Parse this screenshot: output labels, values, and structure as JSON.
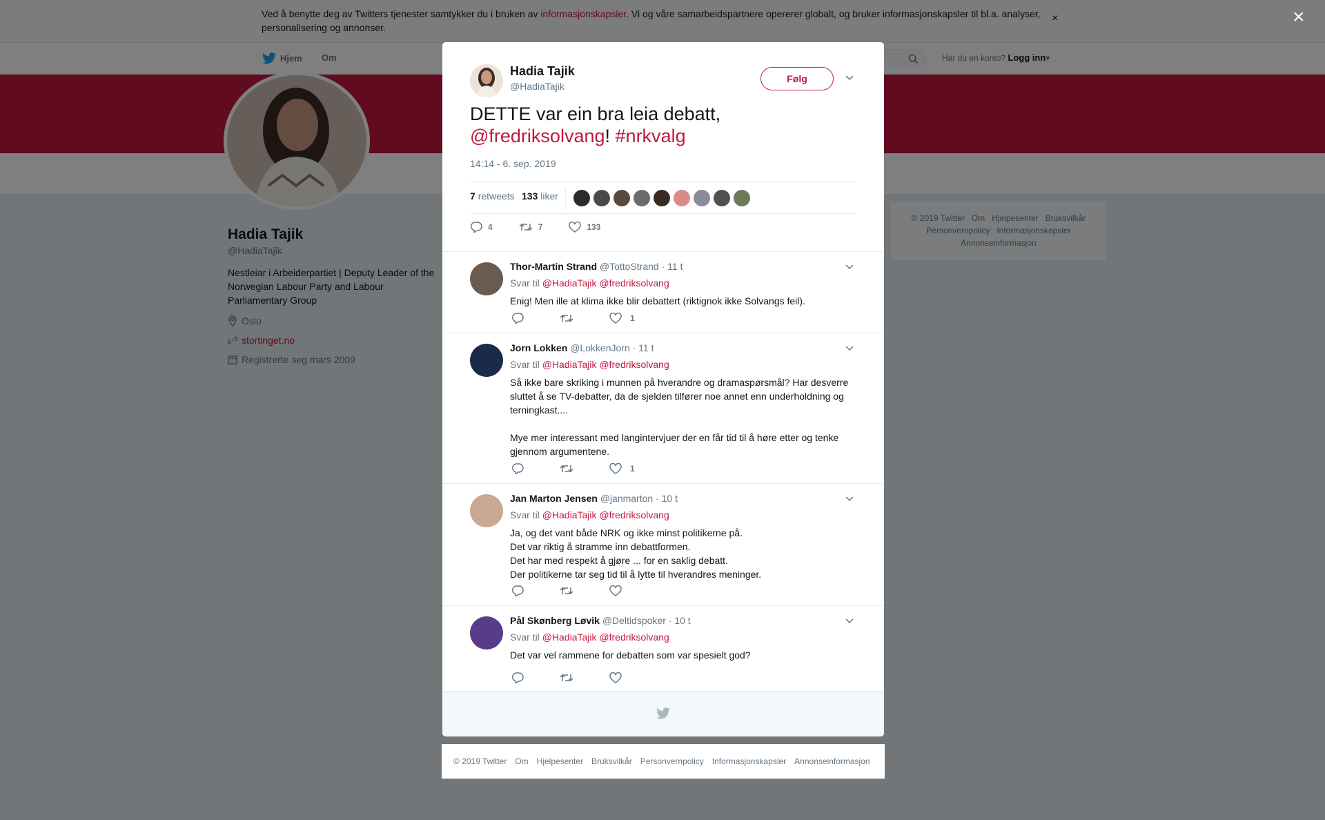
{
  "cookie": {
    "text_before": "Ved å benytte deg av Twitters tjenester samtykker du i bruken av ",
    "link": "informasjonskapsler",
    "text_after": ". Vi og våre samarbeidspartnere opererer globalt, og bruker informasjonskapsler til bl.a. analyser, personalisering og annonser.",
    "close": "×"
  },
  "nav": {
    "home": "Hjem",
    "about": "Om",
    "login_prompt": "Har du en konto?",
    "login": "Logg inn",
    "login_caret": "▾"
  },
  "profile": {
    "name": "Hadia Tajik",
    "handle": "@HadiaTajik",
    "bio": "Nestleiar i Arbeiderpartiet | Deputy Leader of the Norwegian Labour Party and Labour Parliamentary Group",
    "location": "Oslo",
    "website": "stortinget.no",
    "joined": "Registrerte seg mars 2009"
  },
  "right_footer": {
    "items": [
      "© 2019 Twitter",
      "Om",
      "Hjelpesenter",
      "Bruksvilkår",
      "Personvernpolicy",
      "Informasjonskapsler",
      "Annonseinformasjon"
    ]
  },
  "modal_close": "×",
  "tweet": {
    "name": "Hadia Tajik",
    "handle": "@HadiaTajik",
    "follow": "Følg",
    "text": "DETTE var ein bra leia debatt,",
    "mention": "@fredriksolvang",
    "excl": "!",
    "hashtag": "#nrkvalg",
    "time": "14:14 - 6. sep. 2019",
    "retweets_count": "7",
    "retweets_label": "retweets",
    "likes_count": "133",
    "likes_label": "liker",
    "action_replies": "4",
    "action_retweets": "7",
    "action_likes": "133",
    "liker_colors": [
      "#2b2b2b",
      "#4a4a4a",
      "#5a4a3c",
      "#6b6b6b",
      "#3a2a20",
      "#d98a8a",
      "#8a8a9a",
      "#505050",
      "#6a7a5a"
    ]
  },
  "replies": [
    {
      "name": "Thor-Martin Strand",
      "handle": "@TottoStrand",
      "time": "· 11 t",
      "reply_to_label": "Svar til",
      "reply_to_1": "@HadiaTajik",
      "reply_to_2": "@fredriksolvang",
      "body": "Enig! Men ille at klima ikke blir debattert (riktignok ikke Solvangs feil).",
      "likes": "1",
      "avatar_color": "#6b5a4e"
    },
    {
      "name": "Jorn Lokken",
      "handle": "@LokkenJorn",
      "time": "· 11 t",
      "reply_to_label": "Svar til",
      "reply_to_1": "@HadiaTajik",
      "reply_to_2": "@fredriksolvang",
      "body": "Så ikke bare skriking i munnen på hverandre og dramaspørsmål? Har desverre sluttet å se TV-debatter, da de sjelden tilfører noe annet enn underholdning og terningkast....\n\nMye mer interessant med langintervjuer der en får tid til å høre etter og tenke gjennom argumentene.",
      "likes": "1",
      "avatar_color": "#1c2a4a"
    },
    {
      "name": "Jan Marton Jensen",
      "handle": "@janmarton",
      "time": "· 10 t",
      "reply_to_label": "Svar til",
      "reply_to_1": "@HadiaTajik",
      "reply_to_2": "@fredriksolvang",
      "body": "Ja, og det vant både NRK og ikke minst politikerne på.\nDet var riktig å stramme inn debattformen.\nDet har med respekt å gjøre ... for en saklig debatt.\nDer politikerne tar seg tid til å lytte til hverandres meninger.",
      "likes": "",
      "avatar_color": "#c9a894"
    },
    {
      "name": "Pål Skønberg Løvik",
      "handle": "@Deltidspoker",
      "time": "· 10 t",
      "reply_to_label": "Svar til",
      "reply_to_1": "@HadiaTajik",
      "reply_to_2": "@fredriksolvang",
      "body": "Det var vel rammene for debatten som var spesielt god?",
      "likes": "",
      "avatar_color": "#5a3a8a"
    }
  ],
  "bottom_footer": {
    "items": [
      "© 2019 Twitter",
      "Om",
      "Hjelpesenter",
      "Bruksvilkår",
      "Personvernpolicy",
      "Informasjonskapsler",
      "Annonseinformasjon"
    ]
  },
  "colors": {
    "accent": "#c3173f",
    "overlay": "rgba(0,0,0,0.5)"
  }
}
